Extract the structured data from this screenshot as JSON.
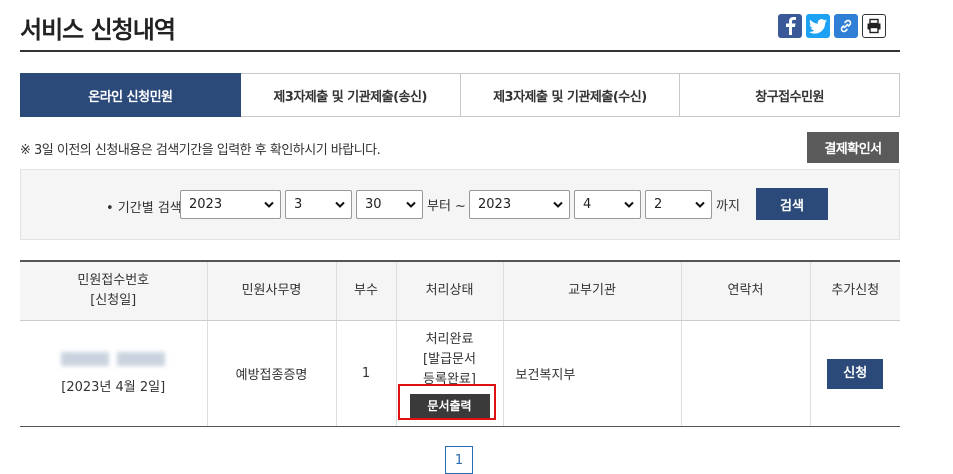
{
  "page": {
    "title": "서비스 신청내역"
  },
  "share": {
    "icons": [
      "facebook-icon",
      "twitter-icon",
      "link-icon",
      "print-icon"
    ]
  },
  "tabs": [
    {
      "label": "온라인 신청민원",
      "active": true
    },
    {
      "label": "제3자제출 및 기관제출(송신)",
      "active": false
    },
    {
      "label": "제3자제출 및 기관제출(수신)",
      "active": false
    },
    {
      "label": "창구접수민원",
      "active": false
    }
  ],
  "notice": "※ 3일 이전의 신청내용은 검색기간을 입력한 후 확인하시기 바랍니다.",
  "payment_button": "결제확인서",
  "search": {
    "label": "• 기간별 검색",
    "from": {
      "year": "2023",
      "month": "3",
      "day": "30"
    },
    "from_suffix": "부터 ~",
    "to": {
      "year": "2023",
      "month": "4",
      "day": "2"
    },
    "to_suffix": "까지",
    "button": "검색"
  },
  "table": {
    "headers": {
      "receipt_no": "민원접수번호",
      "receipt_date": "[신청일]",
      "name": "민원사무명",
      "copies": "부수",
      "status": "처리상태",
      "agency": "교부기관",
      "contact": "연락처",
      "extra": "추가신청"
    },
    "rows": [
      {
        "date": "[2023년 4월 2일]",
        "name": "예방접종증명",
        "copies": "1",
        "status_line1": "처리완료",
        "status_line2": "[발급문서",
        "status_line3": "등록완료]",
        "doc_button": "문서출력",
        "agency": "보건복지부",
        "contact": "",
        "apply_button": "신청"
      }
    ]
  },
  "pager": {
    "current": "1"
  },
  "colors": {
    "primary": "#2b4a7a",
    "highlight": "#e01010",
    "dark_button": "#5a5a5a"
  }
}
